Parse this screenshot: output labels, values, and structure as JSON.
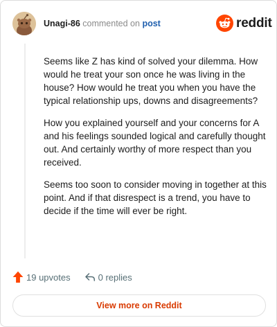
{
  "comment": {
    "username": "Unagi-86",
    "commented_on_text": "commented on",
    "post_link_label": "post",
    "paragraphs": [
      "Seems like Z has kind of solved your dilemma. How would he treat your son once he was living in the house? How would he treat you when you have the typical relationship ups, downs and disagreements?",
      "How you explained yourself and your concerns for A and his feelings sounded logical and carefully thought out. And certainly worthy of more respect than you received.",
      "Seems too soon to consider moving in together at this point. And if that disrespect is a trend, you have to decide if the time will ever be right."
    ]
  },
  "brand": {
    "wordmark": "reddit",
    "accent_color": "#ff4500"
  },
  "actions": {
    "upvotes_label": "19 upvotes",
    "replies_label": "0 replies"
  },
  "footer": {
    "view_more_label": "View more on Reddit"
  },
  "icons": {
    "avatar": "snoo-avatar",
    "brand_logo": "reddit-logo-icon",
    "upvote": "upvote-arrow-icon",
    "reply": "reply-arrow-icon"
  }
}
